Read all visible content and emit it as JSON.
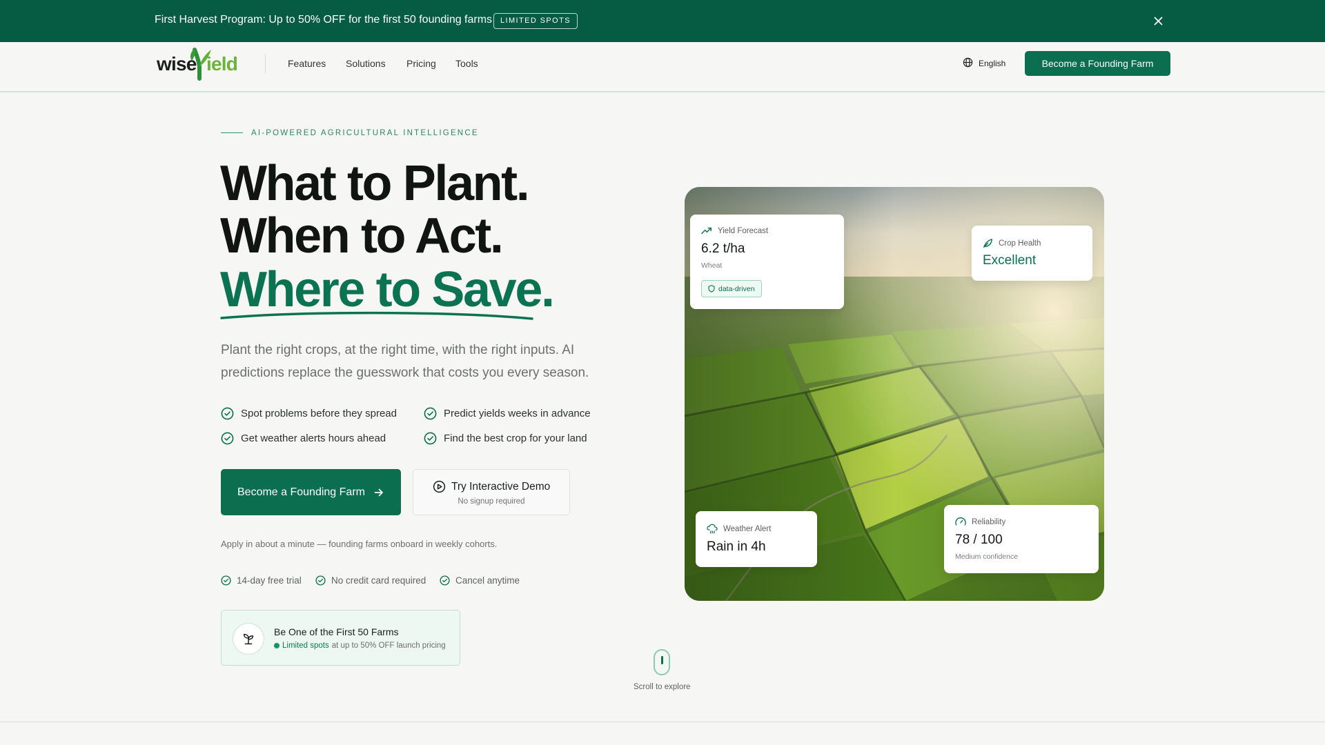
{
  "promo": {
    "text": "First Harvest Program: Up to 50% OFF for the first 50 founding farms",
    "badge": "LIMITED SPOTS"
  },
  "nav": {
    "logo_text": "wiseYield",
    "links": [
      "Features",
      "Solutions",
      "Pricing",
      "Tools"
    ],
    "language": "English",
    "cta": "Become a Founding Farm"
  },
  "hero": {
    "eyebrow": "AI-POWERED AGRICULTURAL INTELLIGENCE",
    "headline": "What to Plant. When to Act.",
    "headline_accent": "Where to Save.",
    "lede": "Plant the right crops, at the right time, with the right inputs. AI predictions replace the guesswork that costs you every season.",
    "features": [
      "Spot problems before they spread",
      "Predict yields weeks in advance",
      "Get weather alerts hours ahead",
      "Find the best crop for your land"
    ],
    "primary_cta": "Become a Founding Farm",
    "secondary_cta": "Try Interactive Demo",
    "secondary_cta_sub": "No signup required",
    "apply_note": "Apply in about a minute — founding farms onboard in weekly cohorts.",
    "trust": [
      "14-day free trial",
      "No credit card required",
      "Cancel anytime"
    ],
    "founding": {
      "title": "Be One of the First 50 Farms",
      "limited": "Limited spots",
      "rest": "at up to 50% OFF launch pricing"
    },
    "scroll": "Scroll to explore"
  },
  "cards": {
    "yield": {
      "label": "Yield Forecast",
      "value": "6.2 t/ha",
      "sub": "Wheat",
      "pill": "data-driven"
    },
    "crop": {
      "label": "Crop Health",
      "value": "Excellent"
    },
    "weather": {
      "label": "Weather Alert",
      "value": "Rain in 4h"
    },
    "reliability": {
      "label": "Reliability",
      "value": "78 / 100",
      "sub": "Medium confidence"
    }
  },
  "colors": {
    "brand": "#0a6e4f",
    "banner": "#055c43",
    "accent_text": "#0b7352",
    "background": "#f6f7f5"
  },
  "icons": {
    "close": "close-icon",
    "globe": "globe-icon",
    "check": "check-circle-icon",
    "arrow": "arrow-right-icon",
    "play": "play-circle-icon",
    "sprout": "sprout-icon",
    "trend": "trending-up-icon",
    "leaf": "leaf-icon",
    "cloud": "cloud-rain-icon",
    "gauge": "gauge-icon",
    "shield": "shield-icon"
  }
}
